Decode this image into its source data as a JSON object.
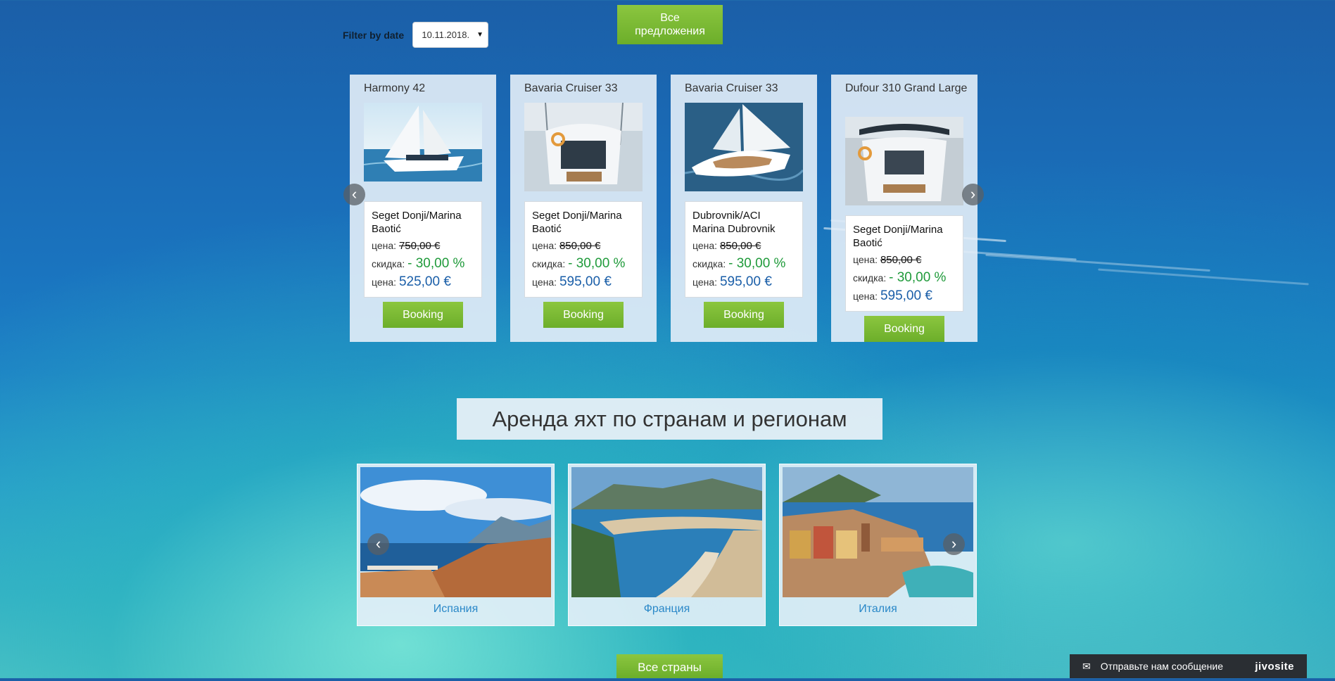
{
  "filter": {
    "label": "Filter by date",
    "date": "10.11.2018."
  },
  "all_offers_button": {
    "line1": "Все",
    "line2": "предложения"
  },
  "offers": [
    {
      "name": "Harmony 42",
      "location": "Seget Donji/Marina Baotić",
      "price_label": "цена:",
      "price_old": "750,00 €",
      "discount_label": "скидка:",
      "discount": "- 30,00 %",
      "price_new_label": "цена:",
      "price_new": "525,00 €",
      "button": "Booking"
    },
    {
      "name": "Bavaria Cruiser 33",
      "location": "Seget Donji/Marina Baotić",
      "price_label": "цена:",
      "price_old": "850,00 €",
      "discount_label": "скидка:",
      "discount": "- 30,00 %",
      "price_new_label": "цена:",
      "price_new": "595,00 €",
      "button": "Booking"
    },
    {
      "name": "Bavaria Cruiser 33",
      "location": "Dubrovnik/ACI Marina Dubrovnik",
      "price_label": "цена:",
      "price_old": "850,00 €",
      "discount_label": "скидка:",
      "discount": "- 30,00 %",
      "price_new_label": "цена:",
      "price_new": "595,00 €",
      "button": "Booking"
    },
    {
      "name": "Dufour 310 Grand Large",
      "location": "Seget Donji/Marina Baotić",
      "price_label": "цена:",
      "price_old": "850,00 €",
      "discount_label": "скидка:",
      "discount": "- 30,00 %",
      "price_new_label": "цена:",
      "price_new": "595,00 €",
      "button": "Booking"
    }
  ],
  "regions_heading": "Аренда яхт по странам и регионам",
  "regions": [
    {
      "name": "Испания"
    },
    {
      "name": "Франция"
    },
    {
      "name": "Италия"
    }
  ],
  "all_countries_button": "Все страны",
  "chat": {
    "text": "Отправьте нам сообщение",
    "brand": "jivosite"
  },
  "icons": {
    "prev": "chevron-left-icon",
    "next": "chevron-right-icon",
    "mail": "mail-icon"
  },
  "colors": {
    "accent_green": "#7cbb35",
    "price_blue": "#1a5ea8",
    "discount_green": "#1f9a3a",
    "region_link": "#2a88c8"
  }
}
